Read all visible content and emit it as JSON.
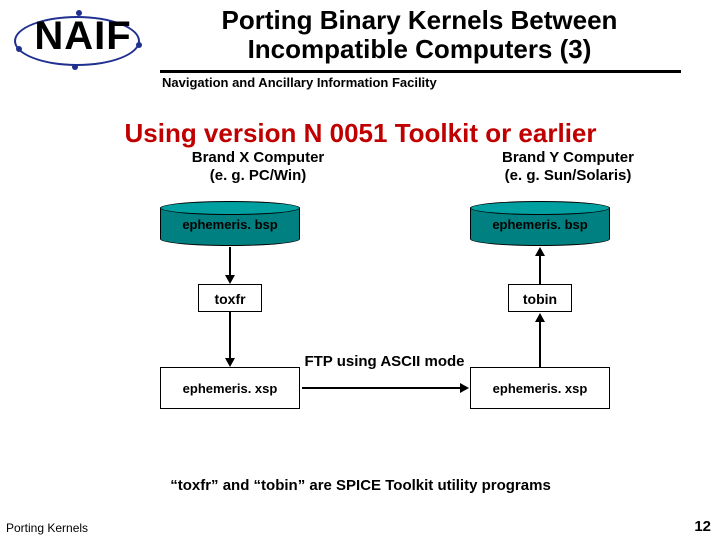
{
  "header": {
    "logo_text": "N  IF",
    "title_line1": "Porting Binary Kernels Between",
    "title_line2": "Incompatible Computers (3)",
    "subtitle": "Navigation and Ancillary Information Facility"
  },
  "section_title": "Using version N 0051 Toolkit or earlier",
  "diagram": {
    "left_label_l1": "Brand X Computer",
    "left_label_l2": "(e. g. PC/Win)",
    "right_label_l1": "Brand Y Computer",
    "right_label_l2": "(e. g. Sun/Solaris)",
    "left_cyl": "ephemeris. bsp",
    "right_cyl": "ephemeris. bsp",
    "left_util": "toxfr",
    "right_util": "tobin",
    "left_xsp": "ephemeris. xsp",
    "right_xsp": "ephemeris. xsp",
    "ftp_label": "FTP using ASCII mode"
  },
  "note": "“toxfr” and “tobin” are SPICE Toolkit utility programs",
  "footer": {
    "left": "Porting Kernels",
    "right": "12"
  }
}
